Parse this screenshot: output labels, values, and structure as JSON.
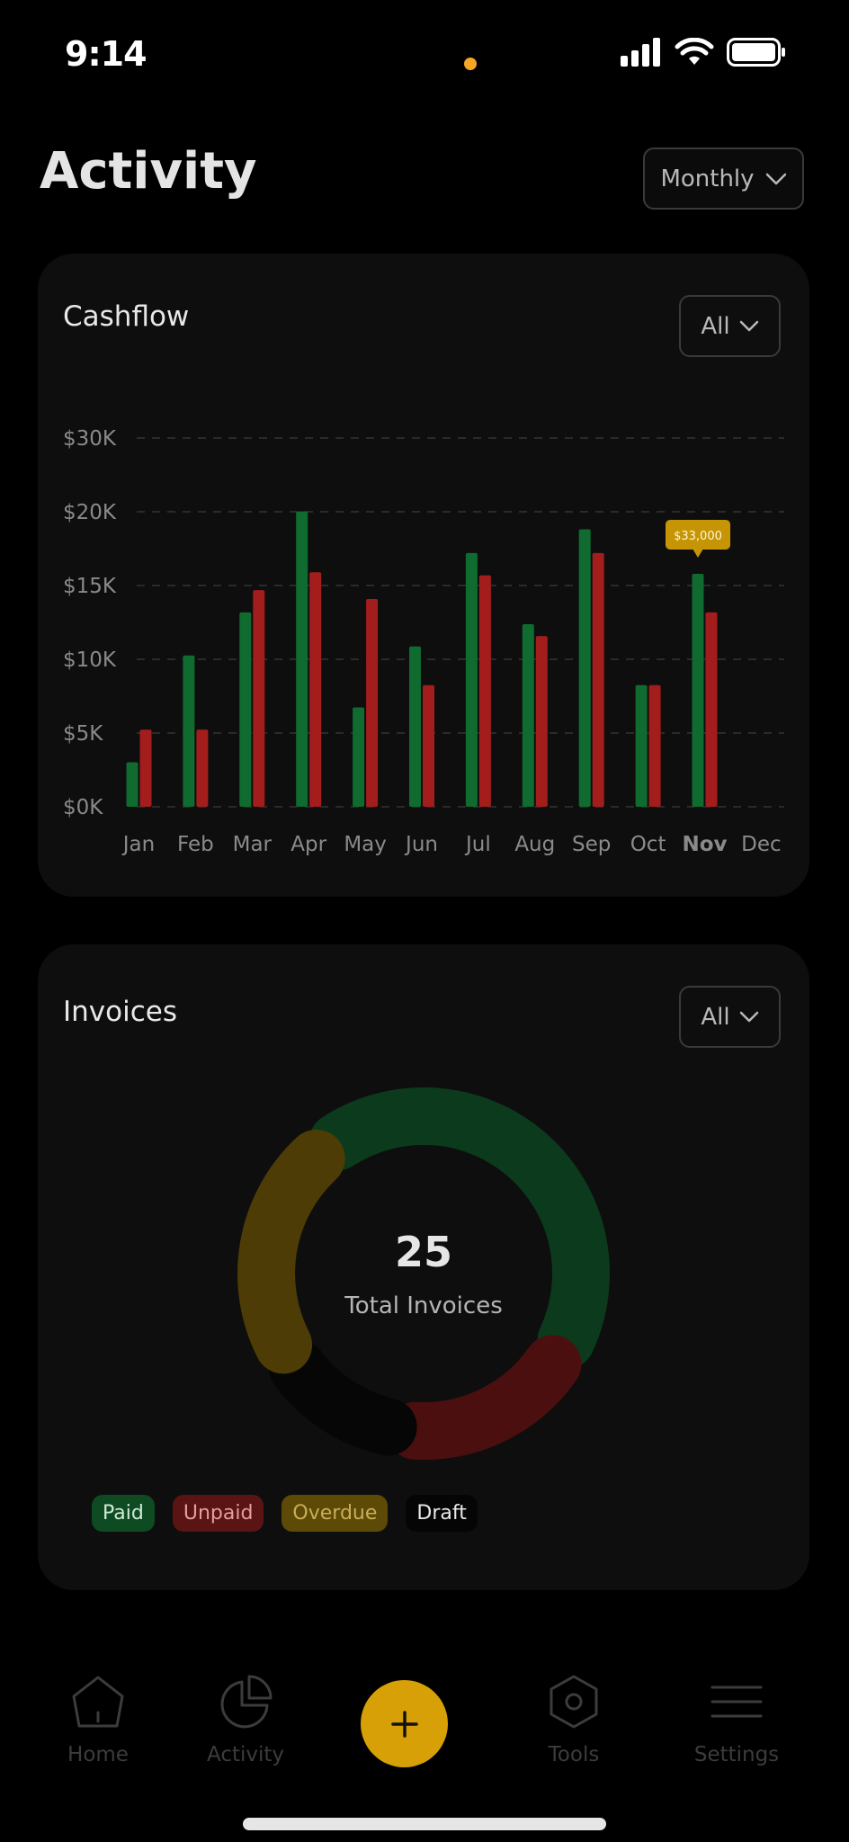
{
  "status_bar": {
    "time": "9:14"
  },
  "header": {
    "title": "Activity",
    "period_select": "Monthly"
  },
  "cashflow": {
    "title": "Cashflow",
    "filter": "All",
    "tooltip": "$33,000",
    "highlighted_month": "Nov"
  },
  "chart_data": {
    "type": "bar",
    "categories": [
      "Jan",
      "Feb",
      "Mar",
      "Apr",
      "May",
      "Jun",
      "Jul",
      "Aug",
      "Sep",
      "Oct",
      "Nov",
      "Dec"
    ],
    "y_ticks": [
      "$0K",
      "$5K",
      "$10K",
      "$15K",
      "$20K",
      "$30K"
    ],
    "ylim": [
      0,
      25000
    ],
    "grid": true,
    "series": [
      {
        "color": "#0f6b2f",
        "values": [
          3000,
          10200,
          13100,
          19900,
          6700,
          10800,
          17100,
          12300,
          18700,
          8200,
          15700,
          null
        ]
      },
      {
        "color": "#a31d1d",
        "values": [
          5200,
          5200,
          14600,
          15800,
          14000,
          8200,
          15600,
          11500,
          17100,
          8200,
          13100,
          null
        ]
      }
    ]
  },
  "invoices": {
    "title": "Invoices",
    "filter": "All",
    "total": "25",
    "total_caption": "Total Invoices",
    "segments": [
      {
        "label": "Paid",
        "color": "#0c3a1c",
        "start_deg": 327,
        "end_deg": 115
      },
      {
        "label": "Unpaid",
        "color": "#4c0f0f",
        "start_deg": 125,
        "end_deg": 183
      },
      {
        "label": "Draft",
        "color": "#060606",
        "start_deg": 193,
        "end_deg": 233
      },
      {
        "label": "Overdue",
        "color": "#4d3c05",
        "start_deg": 243,
        "end_deg": 317
      }
    ],
    "legend": [
      {
        "label": "Paid"
      },
      {
        "label": "Unpaid"
      },
      {
        "label": "Overdue"
      },
      {
        "label": "Draft"
      }
    ]
  },
  "tab_bar": {
    "tabs": [
      {
        "label": "Home",
        "icon": "home-icon"
      },
      {
        "label": "Activity",
        "icon": "pie-chart-icon"
      },
      {
        "label": "Tools",
        "icon": "hexagon-icon"
      },
      {
        "label": "Settings",
        "icon": "menu-icon"
      }
    ],
    "fab_icon": "plus-icon"
  }
}
